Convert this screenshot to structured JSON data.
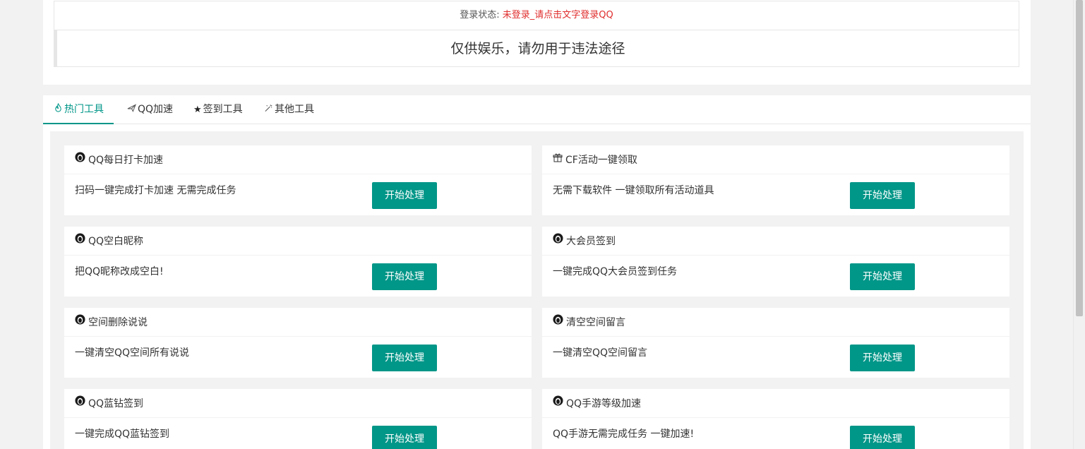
{
  "status": {
    "label": "登录状态: ",
    "value": "未登录_请点击文字登录QQ",
    "value_color": "#e02d2d"
  },
  "notice": "仅供娱乐，请勿用于违法途径",
  "tabs": [
    {
      "icon": "fire-icon",
      "label": "热门工具",
      "active": true
    },
    {
      "icon": "paper-plane-icon",
      "label": "QQ加速",
      "active": false
    },
    {
      "icon": "star-icon",
      "label": "签到工具",
      "active": false
    },
    {
      "icon": "magic-wand-icon",
      "label": "其他工具",
      "active": false
    }
  ],
  "accent_color": "#009688",
  "cards": [
    {
      "icon": "qq-penguin-icon",
      "title": "QQ每日打卡加速",
      "desc": "扫码一键完成打卡加速 无需完成任务",
      "button": "开始处理"
    },
    {
      "icon": "gift-icon",
      "title": "CF活动一键领取",
      "desc": "无需下载软件 一键领取所有活动道具",
      "button": "开始处理"
    },
    {
      "icon": "qq-penguin-icon",
      "title": "QQ空白昵称",
      "desc": "把QQ昵称改成空白!",
      "button": "开始处理"
    },
    {
      "icon": "qq-penguin-icon",
      "title": "大会员签到",
      "desc": "一键完成QQ大会员签到任务",
      "button": "开始处理"
    },
    {
      "icon": "qq-penguin-icon",
      "title": "空间删除说说",
      "desc": "一键清空QQ空间所有说说",
      "button": "开始处理"
    },
    {
      "icon": "qq-penguin-icon",
      "title": "清空空间留言",
      "desc": "一键清空QQ空间留言",
      "button": "开始处理"
    },
    {
      "icon": "qq-penguin-icon",
      "title": "QQ蓝钻签到",
      "desc": "一键完成QQ蓝钻签到",
      "button": "开始处理"
    },
    {
      "icon": "qq-penguin-icon",
      "title": "QQ手游等级加速",
      "desc": "QQ手游无需完成任务 一键加速!",
      "button": "开始处理"
    }
  ]
}
